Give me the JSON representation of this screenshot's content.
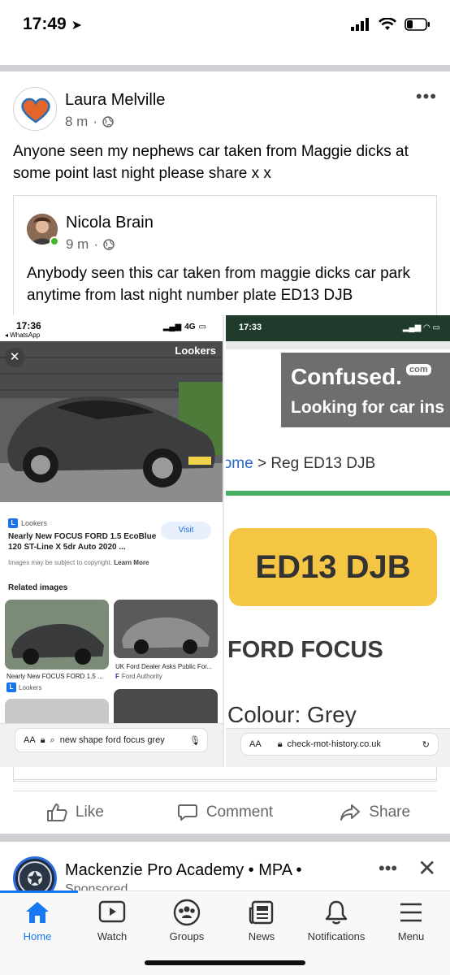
{
  "status_bar": {
    "time": "17:49"
  },
  "post": {
    "author": "Laura Melville",
    "time": "8 m",
    "text": "Anyone seen my nephews car taken from Maggie dicks at some point last night please share x x",
    "shared": {
      "author": "Nicola Brain",
      "time": "9 m",
      "text": "Anybody seen this car taken from maggie dicks car park anytime from last night number plate ED13 DJB"
    },
    "left_image": {
      "time": "17:36",
      "back_app": "◂ WhatsApp",
      "network": "4G",
      "logo": "Lookers",
      "source": "Lookers",
      "title": "Nearly New FOCUS FORD 1.5 EcoBlue 120 ST-Line X 5dr Auto 2020 ...",
      "visit": "Visit",
      "copyright_text": "Images may be subject to copyright.",
      "learn_more": "Learn More",
      "related_heading": "Related images",
      "related1_caption": "Nearly New FOCUS FORD 1.5 ...",
      "related1_source": "Lookers",
      "related2_caption": "UK Ford Dealer Asks Public For...",
      "related2_source": "Ford Authority",
      "url_aa": "AA",
      "url_text": "new shape ford focus grey"
    },
    "right_image": {
      "time": "17:33",
      "confused_title": "Confused.",
      "confused_com": "com",
      "confused_sub": "Looking for car ins",
      "crumb_home": "Home",
      "crumb_rest": " > Reg ED13 DJB",
      "plate": "ED13 DJB",
      "make": "FORD FOCUS",
      "colour": "Colour: Grey",
      "url_aa": "AA",
      "url_text": "check-mot-history.co.uk"
    },
    "actions": {
      "like": "Like",
      "comment": "Comment",
      "share": "Share"
    }
  },
  "next_post": {
    "author": "Mackenzie Pro Academy • MPA •",
    "sub": "Sponsored"
  },
  "tabs": [
    {
      "label": "Home",
      "icon": "home-icon"
    },
    {
      "label": "Watch",
      "icon": "watch-icon"
    },
    {
      "label": "Groups",
      "icon": "groups-icon"
    },
    {
      "label": "News",
      "icon": "news-icon"
    },
    {
      "label": "Notifications",
      "icon": "bell-icon"
    },
    {
      "label": "Menu",
      "icon": "menu-icon"
    }
  ],
  "colors": {
    "brand": "#1877f2",
    "plate_yellow": "#f4c644",
    "confused_gray": "#6e6e6e",
    "mot_green": "#48b064"
  }
}
